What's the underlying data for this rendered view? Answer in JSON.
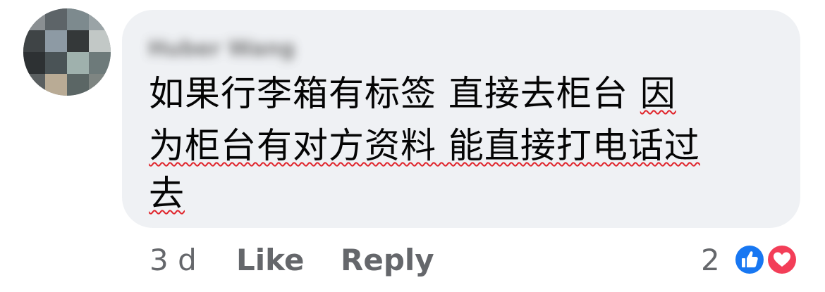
{
  "comment": {
    "author_name": "Huber Wang",
    "text_lines": [
      {
        "plain": "如果行李箱有标签 直接去柜台 ",
        "flagged": "因"
      },
      {
        "plain": "",
        "flagged": "为柜台有对方资料 能直接打电话过"
      },
      {
        "plain": "",
        "flagged": "去"
      }
    ]
  },
  "meta": {
    "timestamp": "3 d",
    "like_label": "Like",
    "reply_label": "Reply",
    "reaction_count": "2"
  },
  "reactions": [
    {
      "icon": "thumbs-up-icon",
      "color": "#1877f2"
    },
    {
      "icon": "heart-icon",
      "color": "#f33e58"
    }
  ],
  "colors": {
    "bubble": "#eff1f4",
    "text": "#050505",
    "meta": "#65676b",
    "spellcheck_underline": "#e0242b"
  }
}
